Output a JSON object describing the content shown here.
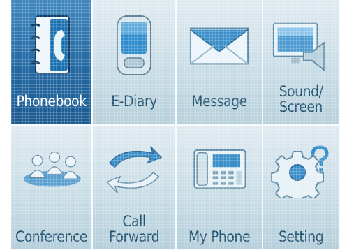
{
  "menu": {
    "items": [
      {
        "id": "phonebook",
        "label": [
          "Phonebook"
        ],
        "icon": "phonebook-icon",
        "selected": true
      },
      {
        "id": "e-diary",
        "label": [
          "E-Diary"
        ],
        "icon": "pda-device-icon",
        "selected": false
      },
      {
        "id": "message",
        "label": [
          "Message"
        ],
        "icon": "envelope-icon",
        "selected": false
      },
      {
        "id": "sound-screen",
        "label": [
          "Sound/",
          "Screen"
        ],
        "icon": "monitor-speaker-icon",
        "selected": false
      },
      {
        "id": "conference",
        "label": [
          "Conference"
        ],
        "icon": "conference-people-icon",
        "selected": false
      },
      {
        "id": "call-forward",
        "label": [
          "Call",
          "Forward"
        ],
        "icon": "call-forward-icon",
        "selected": false
      },
      {
        "id": "my-phone",
        "label": [
          "My Phone"
        ],
        "icon": "desk-phone-icon",
        "selected": false
      },
      {
        "id": "setting",
        "label": [
          "Setting"
        ],
        "icon": "gear-question-icon",
        "selected": false
      }
    ]
  },
  "colors": {
    "selected_tile": "#2468a2",
    "tile": "#c9dde6",
    "label_text": "#1d4f6e",
    "selected_label_text": "#ffffff"
  }
}
